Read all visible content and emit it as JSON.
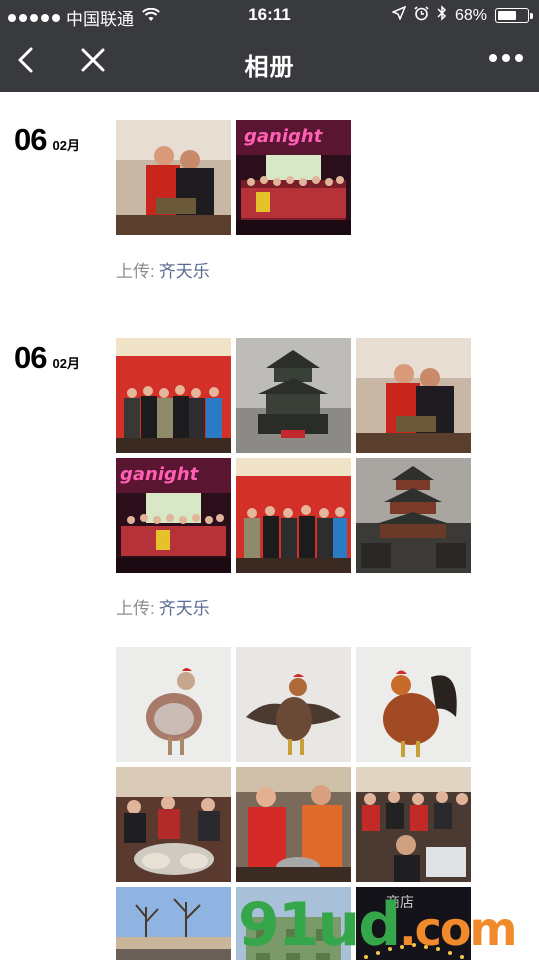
{
  "status_bar": {
    "carrier": "中国联通",
    "time": "16:11",
    "battery_text": "68%",
    "battery_level": 0.68,
    "icons": [
      "signal-dots-icon",
      "wifi-icon",
      "location-icon",
      "alarm-icon",
      "bluetooth-icon",
      "battery-icon"
    ]
  },
  "nav": {
    "title": "相册",
    "back_icon": "chevron-left-icon",
    "close_icon": "close-icon",
    "more_icon": "more-icon"
  },
  "posts": [
    {
      "day": "06",
      "month": "02月",
      "uploader_label": "上传:",
      "uploader_name": "齐天乐",
      "photos": [
        "two-men-photo",
        "group-stage-photo"
      ]
    },
    {
      "day": "06",
      "month": "02月",
      "uploader_label": "上传:",
      "uploader_name": "齐天乐",
      "photos": [
        "group-red-backdrop-photo",
        "temple-model-photo",
        "two-men-photo",
        "group-stage-photo",
        "group-red-backdrop-photo",
        "temple-hall-photo"
      ]
    },
    {
      "photos": [
        "rooster-photo-1",
        "rooster-photo-2",
        "rooster-photo-3",
        "dumpling-table-photo-1",
        "woman-apron-photo",
        "dumpling-table-photo-2",
        "park-trees-photo",
        "green-building-photo",
        "night-lights-photo"
      ]
    }
  ],
  "watermark": {
    "part1": "91ud",
    "part2": ".com",
    "signature": "商店"
  },
  "colors": {
    "header_bg": "#393a3e",
    "uploader_name": "#5b6a92",
    "uploader_label": "#8e8e8e"
  }
}
